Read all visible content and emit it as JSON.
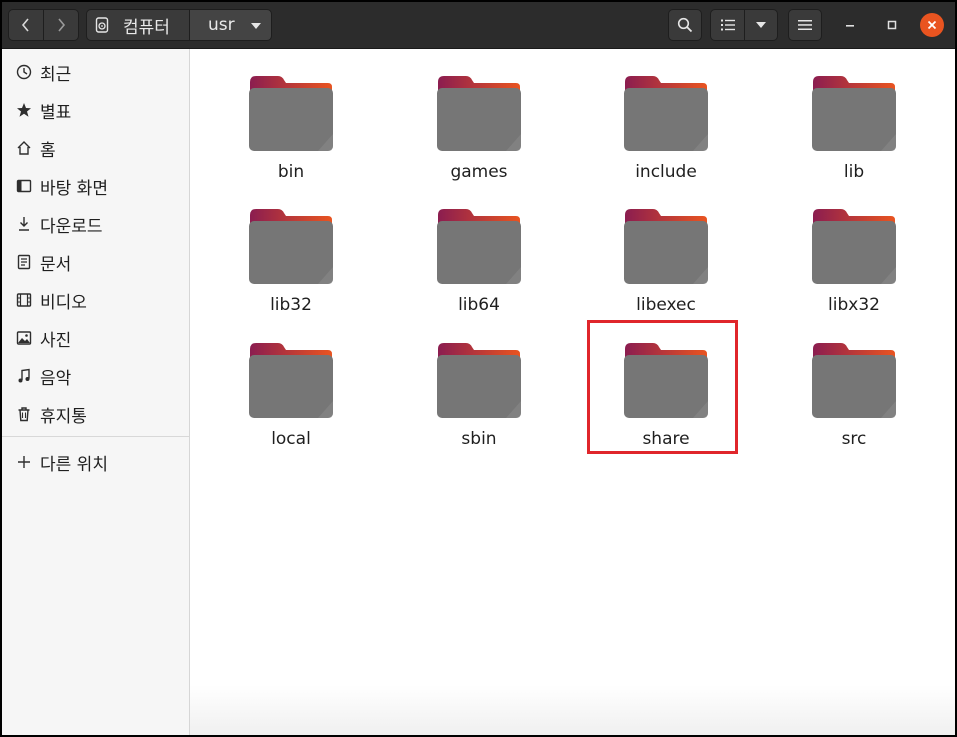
{
  "header": {
    "path": [
      "컴퓨터",
      "usr"
    ],
    "icons": {
      "back": "chevron-left-icon",
      "forward": "chevron-right-icon",
      "disk": "drive-icon",
      "search": "search-icon",
      "view": "list-view-icon",
      "view_options": "chevron-down-icon",
      "menu": "hamburger-menu-icon",
      "minimize": "minimize-icon",
      "maximize": "maximize-icon",
      "close": "close-icon"
    },
    "close_color": "#e95420"
  },
  "sidebar": {
    "items": [
      {
        "label": "최근",
        "icon": "clock-icon"
      },
      {
        "label": "별표",
        "icon": "star-icon"
      },
      {
        "label": "홈",
        "icon": "home-icon"
      },
      {
        "label": "바탕 화면",
        "icon": "desktop-icon"
      },
      {
        "label": "다운로드",
        "icon": "download-icon"
      },
      {
        "label": "문서",
        "icon": "document-icon"
      },
      {
        "label": "비디오",
        "icon": "video-icon"
      },
      {
        "label": "사진",
        "icon": "picture-icon"
      },
      {
        "label": "음악",
        "icon": "music-icon"
      },
      {
        "label": "휴지통",
        "icon": "trash-icon"
      }
    ],
    "other_locations": {
      "label": "다른 위치",
      "icon": "plus-icon"
    }
  },
  "files": [
    {
      "name": "bin"
    },
    {
      "name": "games"
    },
    {
      "name": "include"
    },
    {
      "name": "lib"
    },
    {
      "name": "lib32"
    },
    {
      "name": "lib64"
    },
    {
      "name": "libexec"
    },
    {
      "name": "libx32"
    },
    {
      "name": "local"
    },
    {
      "name": "sbin"
    },
    {
      "name": "share"
    },
    {
      "name": "src"
    }
  ],
  "highlighted_item": "share",
  "colors": {
    "folder_body": "#767676",
    "folder_tab_start": "#8b1d50",
    "folder_tab_end": "#e95420",
    "highlight": "#e0262b"
  }
}
